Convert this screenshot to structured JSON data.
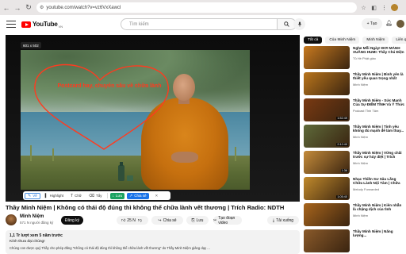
{
  "browser": {
    "url": "youtube.com/watch?v=vz6VxXawcI",
    "nav_back": "←",
    "nav_forward": "→",
    "nav_reload": "↻"
  },
  "header": {
    "logo_text": "YouTube",
    "logo_sup": "VN",
    "search_placeholder": "Tìm kiếm",
    "create_label": "+ Tạo"
  },
  "player": {
    "size_badge": "601 x 502",
    "annotation_text": "Postcard hay, chuyên sâu về chữa lành",
    "accent_color": "#ff3b1f"
  },
  "annotation_toolbar": {
    "draw": "Vẽ",
    "highlight": "Highlight",
    "note": "Chữ",
    "erase": "Tẩy",
    "save": "Lưu",
    "share": "Chia sẻ",
    "close": "✕"
  },
  "video": {
    "title": "Thầy Minh Niệm | Không có thái độ đúng thì không thể chữa lành vết thương | Trích Radio: NDTH",
    "channel_name": "Minh Niệm",
    "channel_subs": "571 N người đăng ký",
    "subscribe": "Đăng ký",
    "likes": "25 N",
    "share": "Chia sẻ",
    "save": "Lưu",
    "clip": "Tạo đoạn video",
    "download": "Tải xuống",
    "desc_meta": "1,1 Tr lượt xem  5 năm trước",
    "desc_line1": "Kính thưa đại chúng!",
    "desc_line2": "Chúng con được quý Thầy cho phép đăng \"Không có thái độ đúng thì không thể chữa lành vết thương\" do Thầy Minh Niệm giảng dạy ..."
  },
  "sidebar": {
    "chips": [
      "Tất cả",
      "Của Minh Niệm",
      "Minh Niệm",
      "Liên q"
    ],
    "items": [
      {
        "title": "Nghe Mỗi Ngày! ĐƠI MẢNH XUÂNG HUMI: Thầy Chú Điện",
        "channel": "Tủ Hè Phật giáo",
        "views": "",
        "duration": "",
        "thumb": "#c87a1f"
      },
      {
        "title": "Thầy Minh Niệm | Bình yên là thiết yếu quan trọng nhất đời...",
        "channel": "Minh Niệm",
        "views": "",
        "duration": "",
        "thumb": "#b9751c"
      },
      {
        "title": "Thầy Minh Niệm - Sức Mạnh Của Sự ĐIỂM TĨNH Và Ý Thức",
        "channel": "Podcast Tỉnh Tâm",
        "views": "",
        "duration": "1:52:49",
        "thumb": "#7a3a12"
      },
      {
        "title": "Thầy Minh Niệm | Tinh yêu không đủ mạnh để làm thay...",
        "channel": "Minh Niệm",
        "views": "",
        "duration": "2:12:40",
        "thumb": "#5e6a3a"
      },
      {
        "title": "Thầy Minh Niệm | Vững chãi trước sự hủy diệt | Trích Radio...",
        "channel": "Minh Niệm",
        "views": "",
        "duration": "1:36",
        "thumb": "#c48b3a"
      },
      {
        "title": "Nhạc Thiền Sư Sâu Lắng Chữa Lành Nội Tâm | Chữa Lành...",
        "channel": "Melody Forwarded",
        "views": "",
        "duration": "1:05:40",
        "thumb": "#c18a2c"
      },
      {
        "title": "Thầy Minh Niệm | Kiên nhẫn là chặng dịch của tình thương...",
        "channel": "Minh Niệm",
        "views": "",
        "duration": "",
        "thumb": "#a8651c"
      },
      {
        "title": "Thầy Minh Niệm | Năng lượng...",
        "channel": "",
        "views": "",
        "duration": "",
        "thumb": "#8a5a2a"
      }
    ]
  }
}
